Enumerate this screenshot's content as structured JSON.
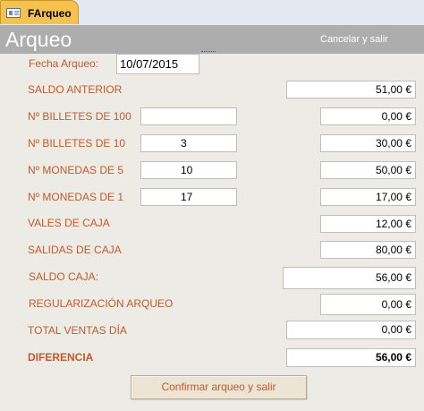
{
  "tab": {
    "label": "FArqueo",
    "icon": "form-icon"
  },
  "header": {
    "title": "Arqueo",
    "cancel_label": "Cancelar y salir"
  },
  "fields": {
    "fecha_label": "Fecha Arqueo:",
    "fecha_value": "10/07/2015",
    "saldo_anterior_label": "SALDO ANTERIOR",
    "saldo_anterior_value": "51,00 €",
    "billetes_100_label": "Nº BILLETES DE 100",
    "billetes_100_qty": "",
    "billetes_100_value": "0,00 €",
    "billetes_10_label": "Nº BILLETES DE 10",
    "billetes_10_qty": "3",
    "billetes_10_value": "30,00 €",
    "monedas_5_label": "Nº MONEDAS DE 5",
    "monedas_5_qty": "10",
    "monedas_5_value": "50,00 €",
    "monedas_1_label": "Nº MONEDAS DE 1",
    "monedas_1_qty": "17",
    "monedas_1_value": "17,00 €",
    "vales_label": "VALES DE CAJA",
    "vales_value": "12,00 €",
    "salidas_label": "SALIDAS DE CAJA",
    "salidas_value": "80,00 €",
    "saldo_caja_label": "SALDO CAJA:",
    "saldo_caja_value": "56,00 €",
    "regularizacion_label": "REGULARIZACIÓN ARQUEO",
    "regularizacion_value": "0,00 €",
    "total_ventas_label": "TOTAL VENTAS DÍA",
    "total_ventas_value": "0,00 €",
    "diferencia_label": "DIFERENCIA",
    "diferencia_value": "56,00 €"
  },
  "actions": {
    "confirm_label": "Confirmar arqueo y salir"
  },
  "colors": {
    "label": "#c25a2c",
    "header": "#adadad",
    "tab": "#f5c24f",
    "background": "#ecebe6"
  }
}
